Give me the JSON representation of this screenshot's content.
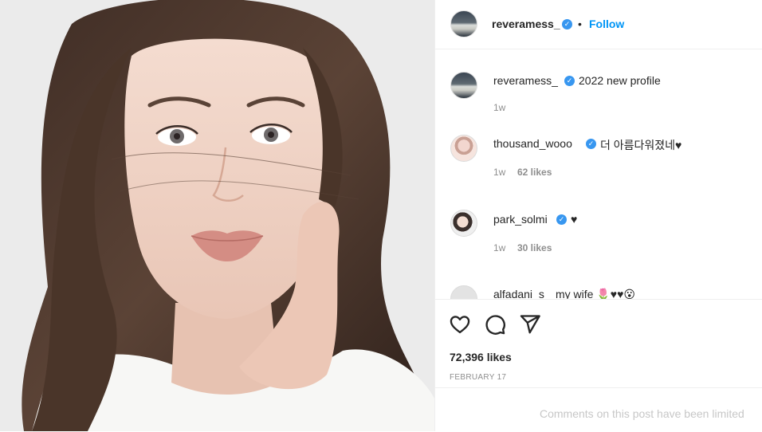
{
  "post": {
    "owner_username": "reveramess_",
    "dot": "•",
    "follow_label": "Follow",
    "caption": {
      "username": "reveramess_",
      "text": "2022 new profile",
      "time": "1w"
    },
    "comments": [
      {
        "username": "thousand_wooo",
        "text": "더 아름다워졌네♥",
        "time": "1w",
        "likes": "62 likes"
      },
      {
        "username": "park_solmi",
        "text": "♥",
        "time": "1w",
        "likes": "30 likes"
      },
      {
        "username": "alfadani_s",
        "text": "my wife 🌷♥♥😮"
      }
    ],
    "likes_count": "72,396 likes",
    "date": "FEBRUARY 17",
    "comments_disabled_text": "Comments on this post have been limited"
  },
  "icons": {
    "verified": "verified-badge-icon",
    "like": "heart-icon",
    "comment": "comment-bubble-icon",
    "share": "paper-plane-icon"
  },
  "colors": {
    "link_blue": "#0095f6",
    "verified_blue": "#3897f0",
    "muted": "#8e8e8e",
    "text": "#262626"
  }
}
